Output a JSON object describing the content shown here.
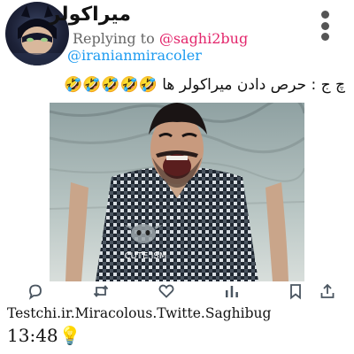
{
  "tweet": {
    "display_name": "میراکولر",
    "replying_prefix": "Replying to ",
    "replying_mention": "@saghi2bug",
    "handle": "@iranianmiracoler",
    "text": "چ ج : حرص دادن میراکولر ها 🤣🤣🤣🤣🤣",
    "media_watermark": "_CUTE.ISM",
    "footer_text": "Testchi.ir.Miracolous.Twitte.Saghibug",
    "time": "13:48",
    "time_emoji": "💡"
  },
  "actions": [
    {
      "icon": "reply-icon"
    },
    {
      "icon": "retweet-icon"
    },
    {
      "icon": "like-icon"
    },
    {
      "icon": "analytics-icon"
    },
    {
      "icon": "bookmark-icon"
    },
    {
      "icon": "share-icon"
    }
  ],
  "colors": {
    "mention": "#e3256b",
    "handle": "#1d9bf0",
    "icon": "#4a5560"
  }
}
